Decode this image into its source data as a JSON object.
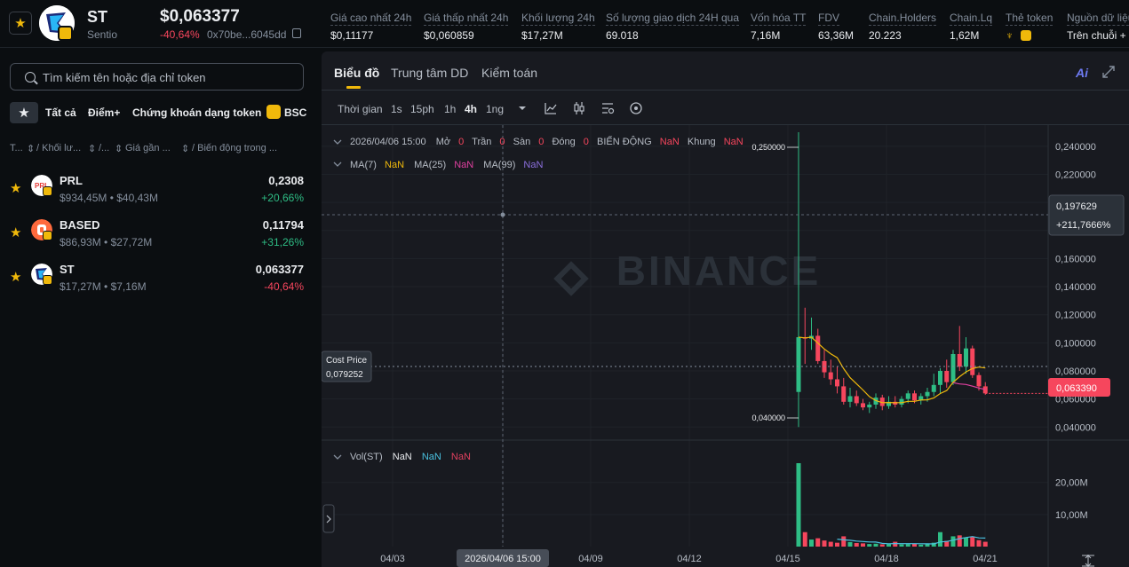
{
  "header": {
    "symbol": "ST",
    "name": "Sentio",
    "price": "$0,063377",
    "change": "-40,64%",
    "address": "0x70be...6045dd",
    "stats": [
      {
        "label": "Giá cao nhất 24h",
        "value": "$0,11177"
      },
      {
        "label": "Giá thấp nhất 24h",
        "value": "$0,060859"
      },
      {
        "label": "Khối lượng 24h",
        "value": "$17,27M"
      },
      {
        "label": "Số lượng giao dịch 24H qua",
        "value": "69.018"
      },
      {
        "label": "Vốn hóa TT",
        "value": "7,16M"
      },
      {
        "label": "FDV",
        "value": "63,36M"
      },
      {
        "label": "Chain.Holders",
        "value": "20.223"
      },
      {
        "label": "Chain.Lq",
        "value": "1,62M"
      },
      {
        "label": "Thẻ token",
        "value": ""
      },
      {
        "label": "Nguồn dữ liệu",
        "value": "Trên chuỗi + L"
      }
    ]
  },
  "sidebar": {
    "search_placeholder": "Tìm kiếm tên hoặc địa chỉ token",
    "filters": [
      "Tất cả",
      "Điểm+",
      "Chứng khoán dạng token",
      "BSC"
    ],
    "columns": [
      "T...",
      "/ Khối lư...",
      "/...",
      "Giá gần ...",
      "/ Biến động trong ..."
    ],
    "tokens": [
      {
        "symbol": "PRL",
        "sub": "$934,45M • $40,43M",
        "price": "0,2308",
        "change": "+20,66%",
        "up": true
      },
      {
        "symbol": "BASED",
        "sub": "$86,93M • $27,72M",
        "price": "0,11794",
        "change": "+31,26%",
        "up": true
      },
      {
        "symbol": "ST",
        "sub": "$17,27M • $7,16M",
        "price": "0,063377",
        "change": "-40,64%",
        "up": false
      }
    ]
  },
  "chart_panel": {
    "tabs": [
      "Biểu đồ",
      "Trung tâm DD",
      "Kiểm toán"
    ],
    "ai_label": "Ai",
    "timeframes": [
      "Thời gian",
      "1s",
      "15ph",
      "1h",
      "4h",
      "1ng"
    ],
    "active_timeframe": "4h",
    "ohlc_legend": {
      "date": "2026/04/06 15:00",
      "labels": [
        "Mở",
        "Trần",
        "Sàn",
        "Đóng",
        "BIẾN ĐỘNG",
        "Khung"
      ],
      "values": [
        "0",
        "0",
        "0",
        "0",
        "NaN",
        "NaN"
      ]
    },
    "ma_legend": {
      "labels": [
        "MA(7)",
        "MA(25)",
        "MA(99)"
      ],
      "values": [
        "NaN",
        "NaN",
        "NaN"
      ]
    },
    "vol_legend": {
      "label": "Vol(ST)",
      "values": [
        "NaN",
        "NaN",
        "NaN"
      ]
    },
    "watermark": "BINANCE",
    "cost_price_label": "Cost Price",
    "cost_price_value": "0,079252",
    "crosshair_price": "0,197629",
    "crosshair_change": "+211,7666%",
    "last_price": "0,063390",
    "crosshair_time": "2026/04/06 15:00",
    "max_label": "0,250000",
    "min_label": "0,040000",
    "colors": {
      "up": "#2ebd85",
      "down": "#f6465d",
      "accent": "#f0b90b",
      "ma7": "#f0b90b",
      "ma25": "#e040a0",
      "ma99": "#8b6fdc"
    }
  },
  "chart_data": {
    "type": "candlestick",
    "price_axis": {
      "ticks": [
        "0,240000",
        "0,220000",
        "0,200000",
        "0,180000",
        "0,160000",
        "0,140000",
        "0,120000",
        "0,100000",
        "0,080000",
        "0,060000",
        "0,040000"
      ],
      "range": [
        0.0345,
        0.2525
      ]
    },
    "volume_axis": {
      "ticks": [
        "20,00M",
        "10,00M"
      ],
      "max": 26000000
    },
    "x_ticks": [
      "04/03",
      "04/06",
      "04/09",
      "04/12",
      "04/15",
      "04/18",
      "04/21"
    ],
    "first_candle_index": 0,
    "candles": [
      {
        "o": 0.065,
        "h": 0.25,
        "l": 0.04,
        "c": 0.104,
        "v": 26000000
      },
      {
        "o": 0.104,
        "h": 0.125,
        "l": 0.085,
        "c": 0.103,
        "v": 4500000
      },
      {
        "o": 0.103,
        "h": 0.118,
        "l": 0.095,
        "c": 0.105,
        "v": 2200000
      },
      {
        "o": 0.105,
        "h": 0.11,
        "l": 0.085,
        "c": 0.087,
        "v": 2600000
      },
      {
        "o": 0.087,
        "h": 0.095,
        "l": 0.075,
        "c": 0.079,
        "v": 1900000
      },
      {
        "o": 0.079,
        "h": 0.088,
        "l": 0.07,
        "c": 0.074,
        "v": 1500000
      },
      {
        "o": 0.074,
        "h": 0.083,
        "l": 0.064,
        "c": 0.069,
        "v": 1200000
      },
      {
        "o": 0.069,
        "h": 0.075,
        "l": 0.056,
        "c": 0.058,
        "v": 3200000
      },
      {
        "o": 0.058,
        "h": 0.068,
        "l": 0.054,
        "c": 0.062,
        "v": 1400000
      },
      {
        "o": 0.062,
        "h": 0.066,
        "l": 0.055,
        "c": 0.057,
        "v": 1100000
      },
      {
        "o": 0.057,
        "h": 0.06,
        "l": 0.052,
        "c": 0.054,
        "v": 1000000
      },
      {
        "o": 0.054,
        "h": 0.058,
        "l": 0.05,
        "c": 0.056,
        "v": 800000
      },
      {
        "o": 0.056,
        "h": 0.064,
        "l": 0.053,
        "c": 0.061,
        "v": 900000
      },
      {
        "o": 0.061,
        "h": 0.063,
        "l": 0.052,
        "c": 0.055,
        "v": 700000
      },
      {
        "o": 0.055,
        "h": 0.062,
        "l": 0.053,
        "c": 0.058,
        "v": 800000
      },
      {
        "o": 0.058,
        "h": 0.062,
        "l": 0.054,
        "c": 0.056,
        "v": 1500000
      },
      {
        "o": 0.056,
        "h": 0.062,
        "l": 0.054,
        "c": 0.06,
        "v": 700000
      },
      {
        "o": 0.06,
        "h": 0.066,
        "l": 0.057,
        "c": 0.064,
        "v": 800000
      },
      {
        "o": 0.064,
        "h": 0.066,
        "l": 0.057,
        "c": 0.059,
        "v": 900000
      },
      {
        "o": 0.059,
        "h": 0.064,
        "l": 0.056,
        "c": 0.062,
        "v": 600000
      },
      {
        "o": 0.062,
        "h": 0.068,
        "l": 0.058,
        "c": 0.065,
        "v": 700000
      },
      {
        "o": 0.065,
        "h": 0.078,
        "l": 0.062,
        "c": 0.07,
        "v": 1200000
      },
      {
        "o": 0.07,
        "h": 0.082,
        "l": 0.064,
        "c": 0.08,
        "v": 4500000
      },
      {
        "o": 0.08,
        "h": 0.088,
        "l": 0.068,
        "c": 0.072,
        "v": 1800000
      },
      {
        "o": 0.072,
        "h": 0.095,
        "l": 0.07,
        "c": 0.092,
        "v": 3200000
      },
      {
        "o": 0.092,
        "h": 0.112,
        "l": 0.08,
        "c": 0.083,
        "v": 3500000
      },
      {
        "o": 0.083,
        "h": 0.104,
        "l": 0.078,
        "c": 0.096,
        "v": 2800000
      },
      {
        "o": 0.096,
        "h": 0.098,
        "l": 0.075,
        "c": 0.077,
        "v": 3000000
      },
      {
        "o": 0.077,
        "h": 0.079,
        "l": 0.066,
        "c": 0.069,
        "v": 2000000
      },
      {
        "o": 0.069,
        "h": 0.072,
        "l": 0.063,
        "c": 0.064,
        "v": 1500000
      }
    ],
    "ma7": [
      0.104,
      0.1035,
      0.104,
      0.0998,
      0.0956,
      0.0922,
      0.0894,
      0.0816,
      0.0752,
      0.0708,
      0.0664,
      0.0617,
      0.0588,
      0.0574,
      0.0575,
      0.0574,
      0.0574,
      0.0583,
      0.0583,
      0.0593,
      0.0594,
      0.0607,
      0.0639,
      0.066,
      0.0719,
      0.0759,
      0.0793,
      0.0817,
      0.0827,
      0.0821
    ],
    "ma25": [
      null,
      null,
      null,
      null,
      null,
      null,
      null,
      null,
      null,
      null,
      null,
      null,
      null,
      null,
      null,
      null,
      null,
      null,
      null,
      null,
      null,
      null,
      null,
      null,
      0.0716,
      0.0707,
      0.0703,
      0.0691,
      0.0678,
      0.0668
    ]
  }
}
